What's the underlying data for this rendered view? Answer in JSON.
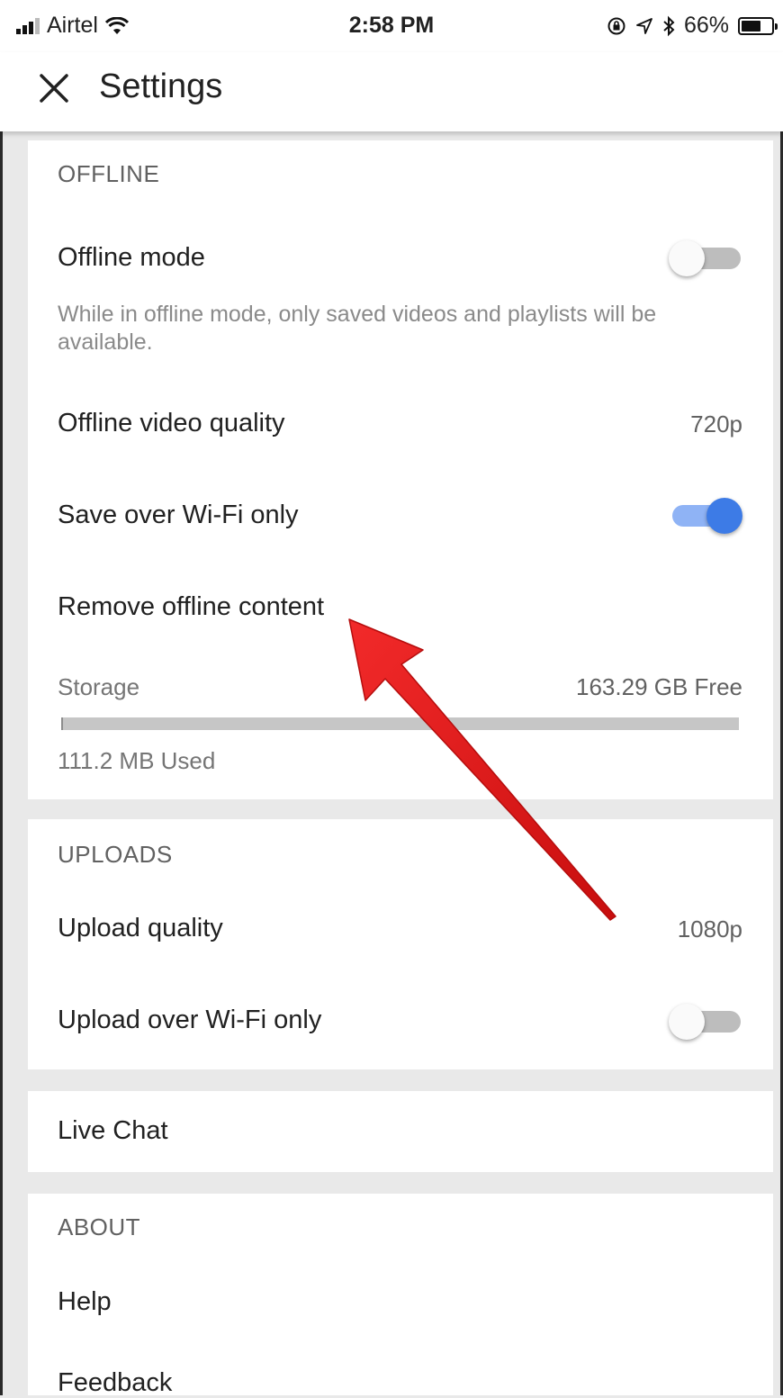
{
  "status_bar": {
    "carrier": "Airtel",
    "time": "2:58 PM",
    "battery": "66%",
    "battery_level": 0.66,
    "icons": [
      "signal-icon",
      "wifi-icon",
      "lock-rotation-icon",
      "location-icon",
      "bluetooth-icon",
      "battery-icon"
    ]
  },
  "app_bar": {
    "title": "Settings",
    "close_icon": "close-icon"
  },
  "offline": {
    "header": "OFFLINE",
    "offline_mode_label": "Offline mode",
    "offline_mode_on": false,
    "offline_mode_desc": "While in offline mode, only saved videos and playlists will be available.",
    "video_quality_label": "Offline video quality",
    "video_quality_value": "720p",
    "wifi_only_label": "Save over Wi-Fi only",
    "wifi_only_on": true,
    "remove_label": "Remove offline content",
    "storage_label": "Storage",
    "storage_free": "163.29 GB Free",
    "storage_used": "111.2 MB Used",
    "storage_used_fraction": 0.0007
  },
  "uploads": {
    "header": "UPLOADS",
    "quality_label": "Upload quality",
    "quality_value": "1080p",
    "wifi_only_label": "Upload over Wi-Fi only",
    "wifi_only_on": false
  },
  "live_chat": {
    "label": "Live Chat"
  },
  "about": {
    "header": "ABOUT",
    "help_label": "Help",
    "feedback_label": "Feedback"
  },
  "colors": {
    "toggle_on": "#3d7be6",
    "toggle_on_track": "#8fb3f5",
    "annotation_arrow": "#e01818"
  }
}
